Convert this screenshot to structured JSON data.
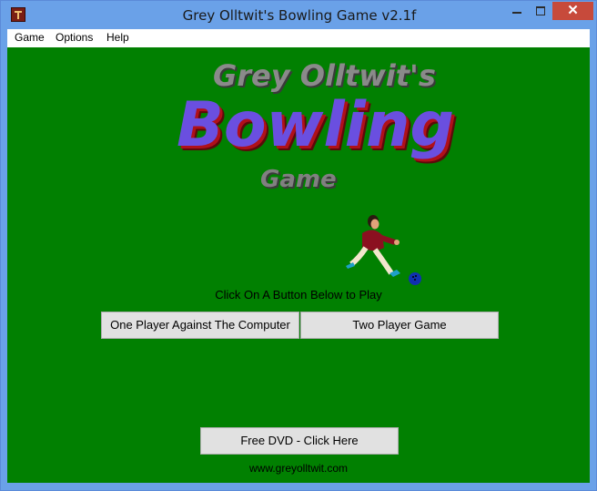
{
  "window": {
    "title": "Grey Olltwit's Bowling Game v2.1f"
  },
  "menu": {
    "items": [
      "Game",
      "Options",
      "Help"
    ]
  },
  "logo": {
    "line1": "Grey Olltwit's",
    "line2": "Bowling",
    "line3": "Game"
  },
  "prompt": "Click On A Button Below to Play",
  "buttons": {
    "one_player": "One Player Against The Computer",
    "two_player": "Two Player Game",
    "dvd": "Free DVD - Click Here"
  },
  "website": "www.greyolltwit.com",
  "colors": {
    "background": "#018001",
    "titlebar": "#6aa1e8",
    "close": "#c74a3b",
    "logo_main": "#6a4fe0"
  }
}
